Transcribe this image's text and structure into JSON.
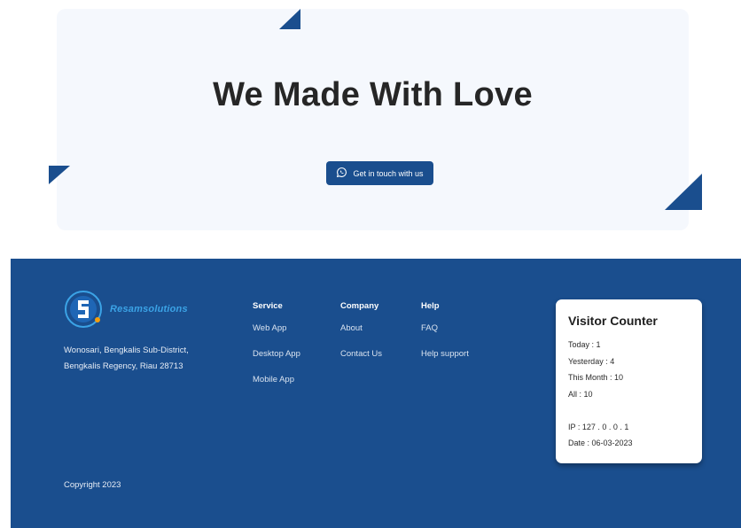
{
  "hero": {
    "title": "We Made With Love",
    "cta_label": "Get in touch with us",
    "cta_icon": "whatsapp-icon"
  },
  "colors": {
    "brand": "#1a4e8e",
    "hero_bg": "#f5f8fd",
    "logo_accent": "#3ba3e6"
  },
  "footer": {
    "logo_text": "Resamsolutions",
    "address_line1": "Wonosari, Bengkalis Sub-District,",
    "address_line2": "Bengkalis Regency, Riau 28713",
    "copyright": "Copyright 2023",
    "columns": [
      {
        "title": "Service",
        "links": [
          "Web App",
          "Desktop App",
          "Mobile App"
        ]
      },
      {
        "title": "Company",
        "links": [
          "About",
          "Contact Us"
        ]
      },
      {
        "title": "Help",
        "links": [
          "FAQ",
          "Help support"
        ]
      }
    ]
  },
  "visitor_counter": {
    "title": "Visitor Counter",
    "today": "Today : 1",
    "yesterday": "Yesterday : 4",
    "this_month": "This Month : 10",
    "all": "All : 10",
    "ip": "IP : 127 . 0 . 0 . 1",
    "date": "Date : 06-03-2023"
  }
}
